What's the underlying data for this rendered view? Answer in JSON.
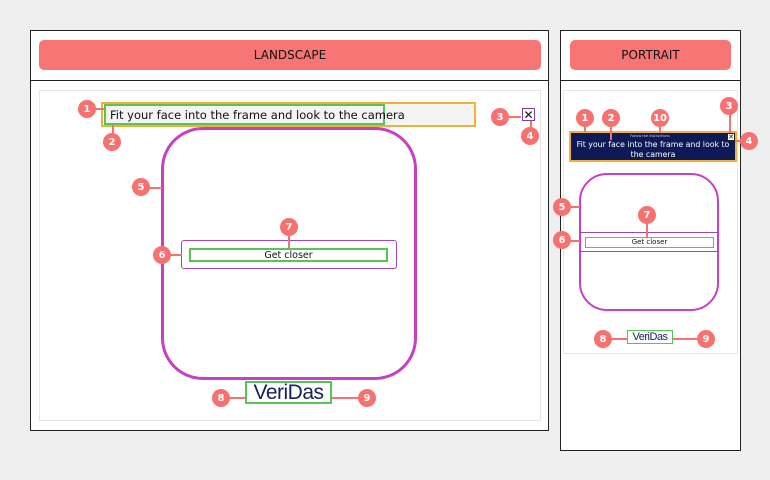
{
  "landscape": {
    "header": "LANDSCAPE",
    "prompt": "Fit your face into the frame and look to the camera",
    "close_icon": "close-icon",
    "feedback": "Get closer",
    "logo": "VeriDas"
  },
  "portrait": {
    "header": "PORTRAIT",
    "subtitle": "Follow the instructions",
    "prompt": "Fit your face into the frame and look to the camera",
    "close_icon": "close-icon",
    "feedback": "Get closer",
    "logo": "VeriDas"
  },
  "badges": {
    "b1": "1",
    "b2": "2",
    "b3": "3",
    "b4": "4",
    "b5": "5",
    "b6": "6",
    "b7": "7",
    "b8": "8",
    "b9": "9",
    "b10": "10"
  },
  "colors": {
    "header": "#f87575",
    "badge": "#f87171",
    "frame": "#c640c6",
    "prompt_border": "#f2b037",
    "element_border": "#55c555",
    "feedback_container": "#9a46c8",
    "portrait_banner": "#0e1a57",
    "logo": "#15205a"
  }
}
